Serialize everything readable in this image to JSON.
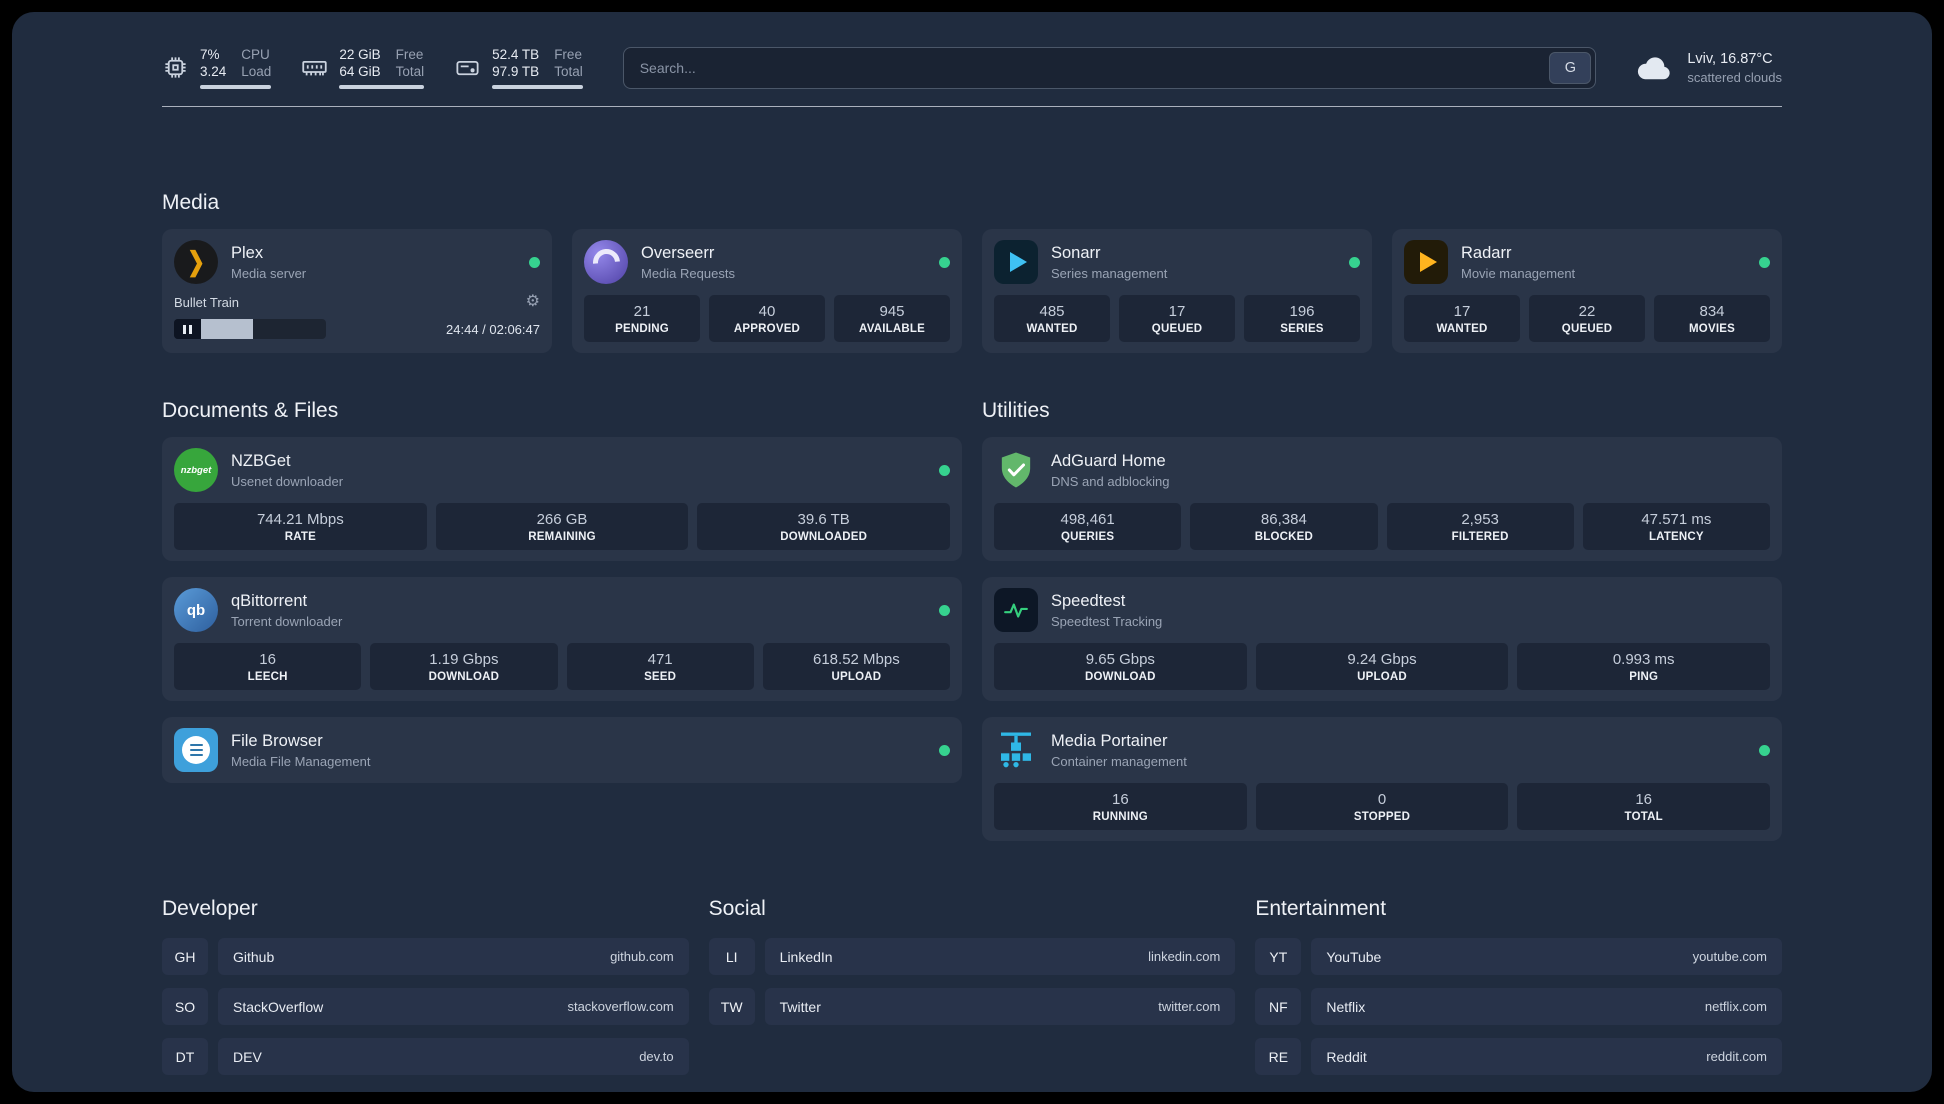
{
  "colors": {
    "background": "#202c3f",
    "card": "#2a3548",
    "stat_block": "#1d2637",
    "status_online": "#36d28f",
    "plex_accent": "#e5a00d"
  },
  "icons": {
    "gear_glyph": "⚙"
  },
  "header": {
    "cpu": {
      "line1": "7%",
      "line2": "3.24",
      "label1": "CPU",
      "label2": "Load"
    },
    "memory": {
      "line1": "22 GiB",
      "line2": "64 GiB",
      "label1": "Free",
      "label2": "Total"
    },
    "disk": {
      "line1": "52.4 TB",
      "line2": "97.9 TB",
      "label1": "Free",
      "label2": "Total"
    },
    "search": {
      "placeholder": "Search...",
      "button_label": "G"
    },
    "weather": {
      "location": "Lviv, 16.87°C",
      "condition": "scattered clouds"
    }
  },
  "media": {
    "title": "Media",
    "plex": {
      "name": "Plex",
      "desc": "Media server",
      "now_playing": "Bullet Train",
      "time": "24:44 / 02:06:47",
      "progress_percent": 35
    },
    "overseerr": {
      "name": "Overseerr",
      "desc": "Media Requests",
      "stats": [
        {
          "value": "21",
          "label": "PENDING"
        },
        {
          "value": "40",
          "label": "APPROVED"
        },
        {
          "value": "945",
          "label": "AVAILABLE"
        }
      ]
    },
    "sonarr": {
      "name": "Sonarr",
      "desc": "Series management",
      "stats": [
        {
          "value": "485",
          "label": "WANTED"
        },
        {
          "value": "17",
          "label": "QUEUED"
        },
        {
          "value": "196",
          "label": "SERIES"
        }
      ]
    },
    "radarr": {
      "name": "Radarr",
      "desc": "Movie management",
      "stats": [
        {
          "value": "17",
          "label": "WANTED"
        },
        {
          "value": "22",
          "label": "QUEUED"
        },
        {
          "value": "834",
          "label": "MOVIES"
        }
      ]
    }
  },
  "documents": {
    "title": "Documents & Files",
    "nzbget": {
      "name": "NZBGet",
      "desc": "Usenet downloader",
      "stats": [
        {
          "value": "744.21 Mbps",
          "label": "RATE"
        },
        {
          "value": "266 GB",
          "label": "REMAINING"
        },
        {
          "value": "39.6 TB",
          "label": "DOWNLOADED"
        }
      ]
    },
    "qbittorrent": {
      "name": "qBittorrent",
      "desc": "Torrent downloader",
      "stats": [
        {
          "value": "16",
          "label": "LEECH"
        },
        {
          "value": "1.19 Gbps",
          "label": "DOWNLOAD"
        },
        {
          "value": "471",
          "label": "SEED"
        },
        {
          "value": "618.52 Mbps",
          "label": "UPLOAD"
        }
      ]
    },
    "filebrowser": {
      "name": "File Browser",
      "desc": "Media File Management"
    }
  },
  "utilities": {
    "title": "Utilities",
    "adguard": {
      "name": "AdGuard Home",
      "desc": "DNS and adblocking",
      "stats": [
        {
          "value": "498,461",
          "label": "QUERIES"
        },
        {
          "value": "86,384",
          "label": "BLOCKED"
        },
        {
          "value": "2,953",
          "label": "FILTERED"
        },
        {
          "value": "47.571 ms",
          "label": "LATENCY"
        }
      ]
    },
    "speedtest": {
      "name": "Speedtest",
      "desc": "Speedtest Tracking",
      "stats": [
        {
          "value": "9.65 Gbps",
          "label": "DOWNLOAD"
        },
        {
          "value": "9.24 Gbps",
          "label": "UPLOAD"
        },
        {
          "value": "0.993 ms",
          "label": "PING"
        }
      ]
    },
    "portainer": {
      "name": "Media Portainer",
      "desc": "Container management",
      "stats": [
        {
          "value": "16",
          "label": "RUNNING"
        },
        {
          "value": "0",
          "label": "STOPPED"
        },
        {
          "value": "16",
          "label": "TOTAL"
        }
      ]
    }
  },
  "bookmarks": {
    "developer": {
      "title": "Developer",
      "items": [
        {
          "abbr": "GH",
          "name": "Github",
          "url": "github.com"
        },
        {
          "abbr": "SO",
          "name": "StackOverflow",
          "url": "stackoverflow.com"
        },
        {
          "abbr": "DT",
          "name": "DEV",
          "url": "dev.to"
        }
      ]
    },
    "social": {
      "title": "Social",
      "items": [
        {
          "abbr": "LI",
          "name": "LinkedIn",
          "url": "linkedin.com"
        },
        {
          "abbr": "TW",
          "name": "Twitter",
          "url": "twitter.com"
        }
      ]
    },
    "entertainment": {
      "title": "Entertainment",
      "items": [
        {
          "abbr": "YT",
          "name": "YouTube",
          "url": "youtube.com"
        },
        {
          "abbr": "NF",
          "name": "Netflix",
          "url": "netflix.com"
        },
        {
          "abbr": "RE",
          "name": "Reddit",
          "url": "reddit.com"
        }
      ]
    }
  }
}
